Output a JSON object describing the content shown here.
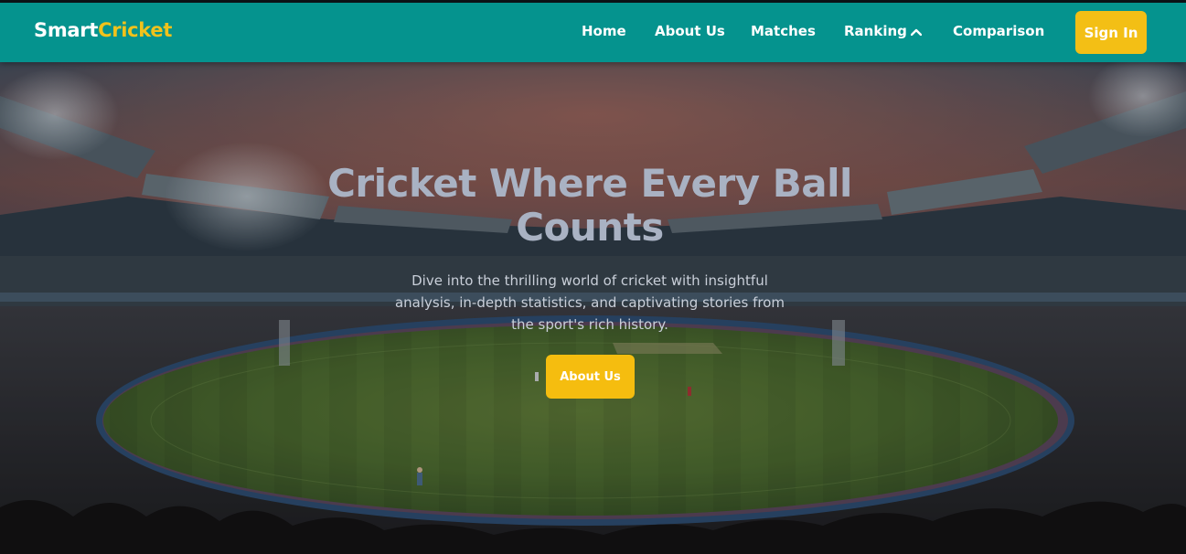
{
  "brand": {
    "name_part1": "Smart",
    "name_part2": "Cricket"
  },
  "nav": {
    "items": [
      {
        "label": "Home"
      },
      {
        "label": "About Us"
      },
      {
        "label": "Matches"
      },
      {
        "label": "Ranking",
        "icon": "chevron-up-icon"
      },
      {
        "label": "Comparison"
      }
    ],
    "signin_label": "Sign In"
  },
  "hero": {
    "title": "Cricket Where Every Ball Counts",
    "subtitle": "Dive into the thrilling world of cricket with insightful analysis, in-depth statistics, and captivating stories from the sport's rich history.",
    "cta_label": "About Us"
  },
  "colors": {
    "nav_bg": "#05938e",
    "accent_yellow": "#f3bf15",
    "brand_accent": "#f1c21b",
    "title_color": "#a9b2c3"
  }
}
